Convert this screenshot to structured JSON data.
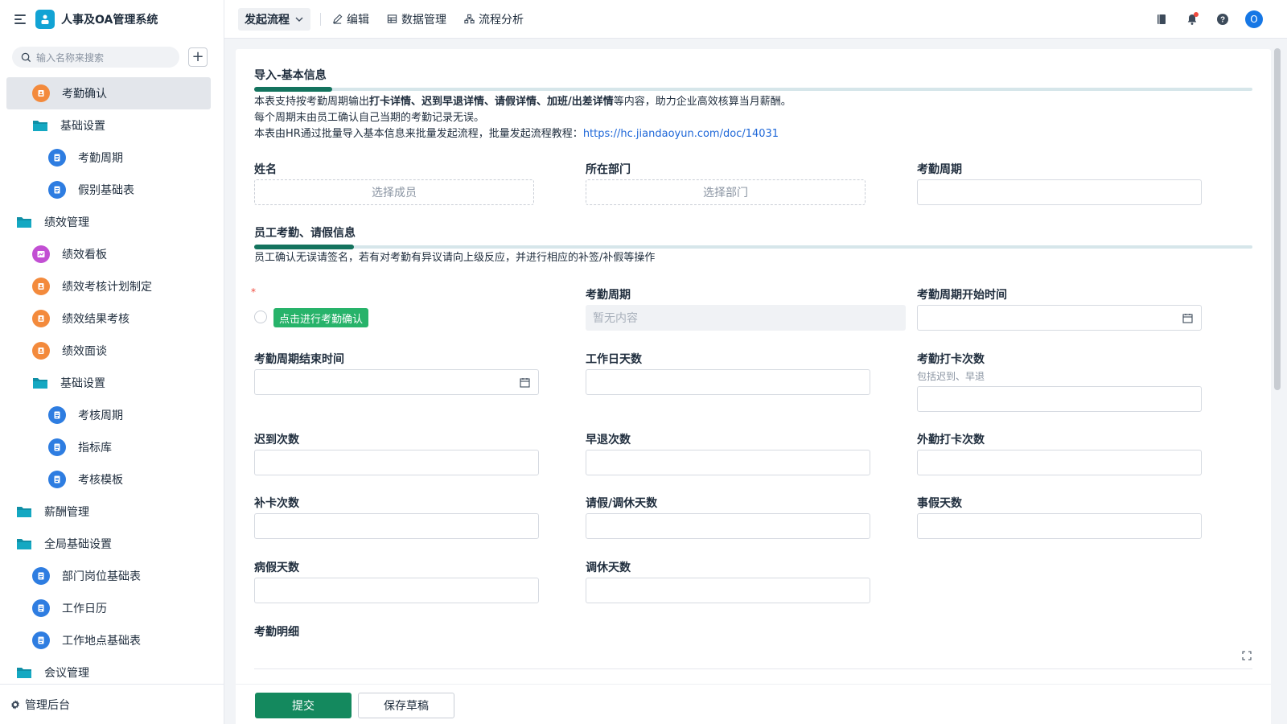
{
  "app": {
    "title": "人事及OA管理系统"
  },
  "sidebar": {
    "search_placeholder": "输入名称来搜索",
    "items": [
      {
        "label": "考勤确认",
        "icon": "orange",
        "indent": 1,
        "active": true
      },
      {
        "label": "基础设置",
        "icon": "folder",
        "indent": 1
      },
      {
        "label": "考勤周期",
        "icon": "blue",
        "indent": 2
      },
      {
        "label": "假别基础表",
        "icon": "blue",
        "indent": 2
      },
      {
        "label": "绩效管理",
        "icon": "folder",
        "indent": 0
      },
      {
        "label": "绩效看板",
        "icon": "purple",
        "indent": 1
      },
      {
        "label": "绩效考核计划制定",
        "icon": "orange",
        "indent": 1
      },
      {
        "label": "绩效结果考核",
        "icon": "orange",
        "indent": 1
      },
      {
        "label": "绩效面谈",
        "icon": "orange",
        "indent": 1
      },
      {
        "label": "基础设置",
        "icon": "folder",
        "indent": 1
      },
      {
        "label": "考核周期",
        "icon": "blue",
        "indent": 2
      },
      {
        "label": "指标库",
        "icon": "blue",
        "indent": 2
      },
      {
        "label": "考核模板",
        "icon": "blue",
        "indent": 2
      },
      {
        "label": "薪酬管理",
        "icon": "folder",
        "indent": 0
      },
      {
        "label": "全局基础设置",
        "icon": "folder",
        "indent": 0
      },
      {
        "label": "部门岗位基础表",
        "icon": "blue",
        "indent": 1
      },
      {
        "label": "工作日历",
        "icon": "blue",
        "indent": 1
      },
      {
        "label": "工作地点基础表",
        "icon": "blue",
        "indent": 1
      },
      {
        "label": "会议管理",
        "icon": "folder",
        "indent": 0
      }
    ],
    "footer": "管理后台"
  },
  "topbar": {
    "flow": "发起流程",
    "edit": "编辑",
    "data": "数据管理",
    "analysis": "流程分析",
    "avatar": "O"
  },
  "form": {
    "section1": {
      "title": "导入-基本信息",
      "desc1_pre": "本表支持按考勤周期输出",
      "desc1_bold": "打卡详情、迟到早退详情、请假详情、加班/出差详情",
      "desc1_post": "等内容，助力企业高效核算当月薪酬。",
      "desc2": "每个周期末由员工确认自己当期的考勤记录无误。",
      "desc3_pre": "本表由HR通过批量导入基本信息来批量发起流程，批量发起流程教程：",
      "desc3_link": "https://hc.jiandaoyun.com/doc/14031"
    },
    "name_label": "姓名",
    "name_placeholder": "选择成员",
    "dept_label": "所在部门",
    "dept_placeholder": "选择部门",
    "period_label": "考勤周期",
    "section2": {
      "title": "员工考勤、请假信息",
      "desc": "员工确认无误请签名，若有对考勤有异议请向上级反应，并进行相应的补签/补假等操作"
    },
    "required_mark": "*",
    "confirm_btn": "点击进行考勤确认",
    "period2_label": "考勤周期",
    "period2_value": "暂无内容",
    "start_label": "考勤周期开始时间",
    "end_label": "考勤周期结束时间",
    "workdays_label": "工作日天数",
    "punch_label": "考勤打卡次数",
    "punch_hint": "包括迟到、早退",
    "late_label": "迟到次数",
    "early_label": "早退次数",
    "outside_label": "外勤打卡次数",
    "makeup_label": "补卡次数",
    "leave_label": "请假/调休天数",
    "personal_label": "事假天数",
    "sick_label": "病假天数",
    "comp_label": "调休天数",
    "detail_label": "考勤明细"
  },
  "footer": {
    "submit": "提交",
    "draft": "保存草稿"
  },
  "colors": {
    "accent": "#14895e",
    "link": "#1e67d8",
    "confirm": "#27b36a"
  }
}
